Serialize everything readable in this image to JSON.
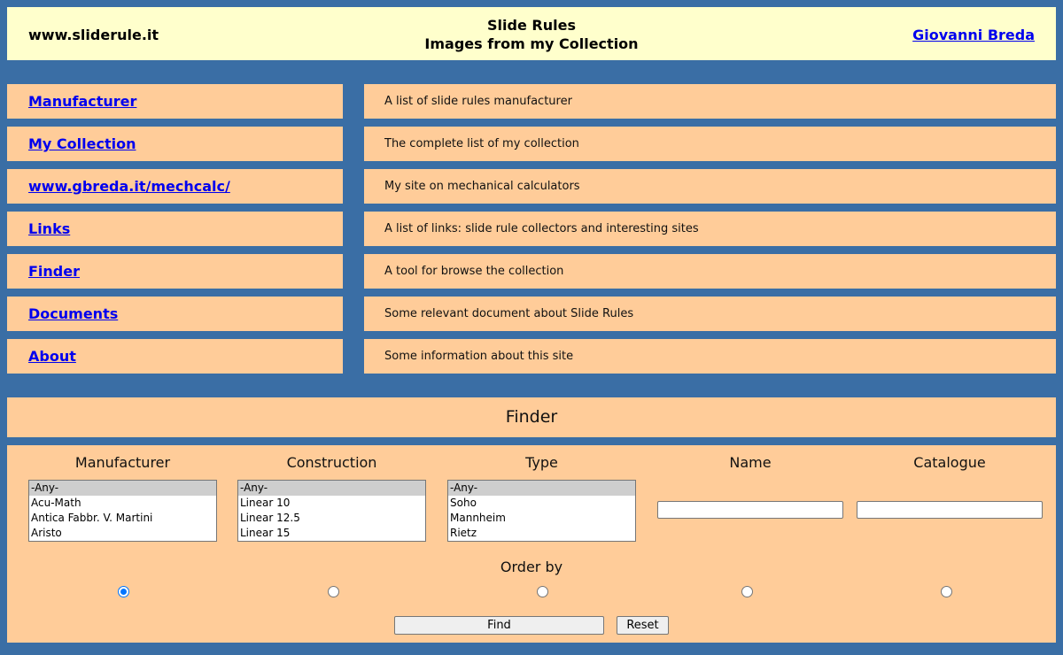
{
  "header": {
    "site": "www.sliderule.it",
    "title_line1": "Slide Rules",
    "title_line2": "Images from my Collection",
    "author": "Giovanni Breda"
  },
  "menu": [
    {
      "label": "Manufacturer",
      "desc": "A list of slide rules manufacturer"
    },
    {
      "label": "My Collection",
      "desc": "The complete list of my collection"
    },
    {
      "label": "www.gbreda.it/mechcalc/",
      "desc": "My site on mechanical calculators"
    },
    {
      "label": "Links",
      "desc": "A list of links: slide rule collectors and interesting sites"
    },
    {
      "label": "Finder",
      "desc": "A tool for browse the collection"
    },
    {
      "label": "Documents",
      "desc": "Some relevant document about Slide Rules"
    },
    {
      "label": "About",
      "desc": "Some information about this site"
    }
  ],
  "finder": {
    "title": "Finder",
    "columns": {
      "manufacturer": "Manufacturer",
      "construction": "Construction",
      "type": "Type",
      "name": "Name",
      "catalogue": "Catalogue"
    },
    "manufacturer_options": [
      "-Any-",
      "Acu-Math",
      "Antica Fabbr. V. Martini",
      "Aristo"
    ],
    "construction_options": [
      "-Any-",
      "Linear 10",
      "Linear 12.5",
      "Linear 15"
    ],
    "type_options": [
      "-Any-",
      "Soho",
      "Mannheim",
      "Rietz"
    ],
    "name_value": "",
    "catalogue_value": "",
    "order_by": "Order by",
    "selected_order": 0,
    "find_label": "Find",
    "reset_label": "Reset"
  },
  "colors": {
    "background": "#3a6ea5",
    "header_bg": "#ffffcc",
    "panel_bg": "#ffcc99",
    "link": "#0000ee"
  }
}
